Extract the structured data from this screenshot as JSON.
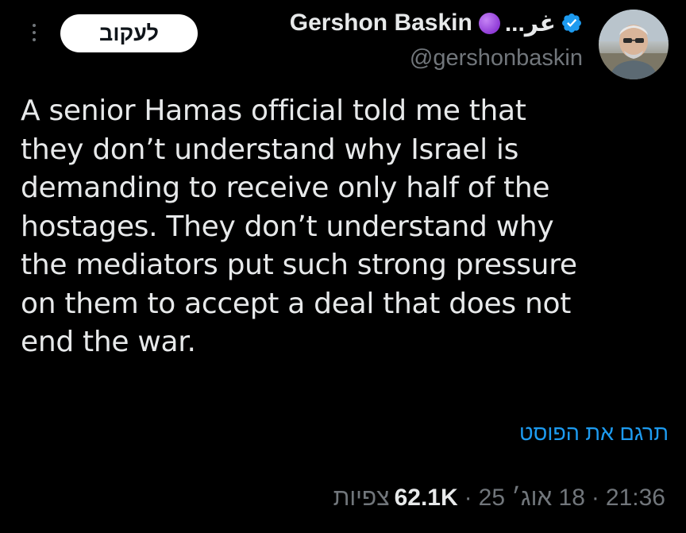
{
  "header": {
    "follow_label": "לעקוב",
    "author_name": "Gershon Baskin",
    "name_suffix": "...غر",
    "handle": "@gershonbaskin"
  },
  "tweet": {
    "lines": [
      "A senior Hamas official told me that",
      "they don’t understand why Israel is",
      "demanding to receive only half of the",
      "hostages. They don’t understand why",
      "the mediators put such strong pressure",
      "on them to accept a deal that does not",
      "end the war."
    ],
    "translate_label": "תרגם את הפוסט"
  },
  "meta": {
    "time": "21:36",
    "date": "18 אוג׳ 25",
    "views_count": "62.1K",
    "views_label": "צפיות",
    "separator": "·"
  },
  "colors": {
    "background": "#000000",
    "text": "#e7e9ea",
    "muted": "#71767b",
    "link": "#1d9bf0",
    "verified": "#1d9bf0"
  },
  "icons": {
    "more": "more-vertical-icon",
    "verified": "verified-badge-icon",
    "emoji": "purple-circle-emoji"
  }
}
